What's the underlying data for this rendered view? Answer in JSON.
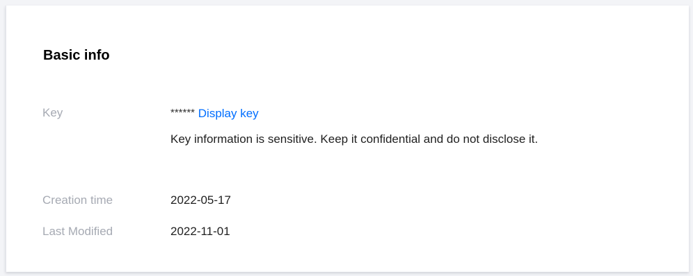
{
  "basic_info": {
    "title": "Basic info",
    "key": {
      "label": "Key",
      "masked_value": "******",
      "display_link": "Display key",
      "note": "Key information is sensitive. Keep it confidential and do not disclose it."
    },
    "creation_time": {
      "label": "Creation time",
      "value": "2022-05-17"
    },
    "last_modified": {
      "label": "Last Modified",
      "value": "2022-11-01"
    }
  }
}
